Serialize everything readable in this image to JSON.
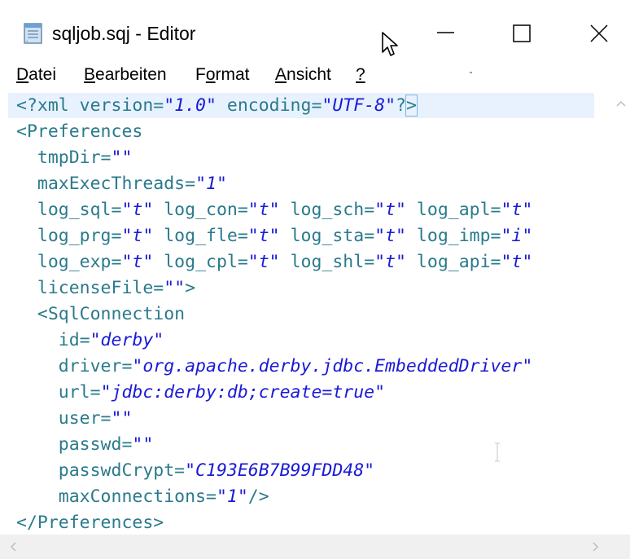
{
  "window": {
    "title": "sqljob.sqj - Editor"
  },
  "menu": {
    "items": [
      {
        "label": "Datei",
        "accel_index": 0
      },
      {
        "label": "Bearbeiten",
        "accel_index": 0
      },
      {
        "label": "Format",
        "accel_index": 1
      },
      {
        "label": "Ansicht",
        "accel_index": 0
      },
      {
        "label": "?",
        "accel_index": 0
      }
    ]
  },
  "icons": {
    "app": "notepad-icon",
    "minimize": "minimize-icon",
    "maximize": "maximize-icon",
    "close": "close-icon",
    "mouse": "mouse-pointer-icon",
    "text_cursor": "text-cursor-icon",
    "scroll_up": "chevron-up-icon",
    "scroll_left": "chevron-left-icon",
    "scroll_right": "chevron-right-icon"
  },
  "colors": {
    "markup": "#2a7a8c",
    "value": "#1a1ad6",
    "current_line": "#e8f2fe"
  },
  "editor": {
    "lines": [
      [
        {
          "t": "p",
          "s": "<?xml version="
        },
        {
          "t": "v",
          "s": "\"1.0\""
        },
        {
          "t": "p",
          "s": " encoding="
        },
        {
          "t": "v",
          "s": "\"UTF-8\""
        },
        {
          "t": "p",
          "s": "?"
        },
        {
          "t": "b",
          "s": ">"
        }
      ],
      [
        {
          "t": "p",
          "s": "<Preferences"
        }
      ],
      [
        {
          "t": "p",
          "s": "  tmpDir="
        },
        {
          "t": "v",
          "s": "\"\""
        }
      ],
      [
        {
          "t": "p",
          "s": "  maxExecThreads="
        },
        {
          "t": "v",
          "s": "\"1\""
        }
      ],
      [
        {
          "t": "p",
          "s": "  log_sql="
        },
        {
          "t": "v",
          "s": "\"t\""
        },
        {
          "t": "p",
          "s": " log_con="
        },
        {
          "t": "v",
          "s": "\"t\""
        },
        {
          "t": "p",
          "s": " log_sch="
        },
        {
          "t": "v",
          "s": "\"t\""
        },
        {
          "t": "p",
          "s": " log_apl="
        },
        {
          "t": "v",
          "s": "\"t\""
        }
      ],
      [
        {
          "t": "p",
          "s": "  log_prg="
        },
        {
          "t": "v",
          "s": "\"t\""
        },
        {
          "t": "p",
          "s": " log_fle="
        },
        {
          "t": "v",
          "s": "\"t\""
        },
        {
          "t": "p",
          "s": " log_sta="
        },
        {
          "t": "v",
          "s": "\"t\""
        },
        {
          "t": "p",
          "s": " log_imp="
        },
        {
          "t": "v",
          "s": "\"i\""
        }
      ],
      [
        {
          "t": "p",
          "s": "  log_exp="
        },
        {
          "t": "v",
          "s": "\"t\""
        },
        {
          "t": "p",
          "s": " log_cpl="
        },
        {
          "t": "v",
          "s": "\"t\""
        },
        {
          "t": "p",
          "s": " log_shl="
        },
        {
          "t": "v",
          "s": "\"t\""
        },
        {
          "t": "p",
          "s": " log_api="
        },
        {
          "t": "v",
          "s": "\"t\""
        }
      ],
      [
        {
          "t": "p",
          "s": "  licenseFile="
        },
        {
          "t": "v",
          "s": "\"\""
        },
        {
          "t": "p",
          "s": ">"
        }
      ],
      [
        {
          "t": "p",
          "s": "  <SqlConnection"
        }
      ],
      [
        {
          "t": "p",
          "s": "    id="
        },
        {
          "t": "v",
          "s": "\"derby\""
        }
      ],
      [
        {
          "t": "p",
          "s": "    driver="
        },
        {
          "t": "v",
          "s": "\"org.apache.derby.jdbc.EmbeddedDriver\""
        }
      ],
      [
        {
          "t": "p",
          "s": "    url="
        },
        {
          "t": "v",
          "s": "\"jdbc:derby:db;create=true\""
        }
      ],
      [
        {
          "t": "p",
          "s": "    user="
        },
        {
          "t": "v",
          "s": "\"\""
        }
      ],
      [
        {
          "t": "p",
          "s": "    passwd="
        },
        {
          "t": "v",
          "s": "\"\""
        }
      ],
      [
        {
          "t": "p",
          "s": "    passwdCrypt="
        },
        {
          "t": "v",
          "s": "\"C193E6B7B99FDD48\""
        }
      ],
      [
        {
          "t": "p",
          "s": "    maxConnections="
        },
        {
          "t": "v",
          "s": "\"1\""
        },
        {
          "t": "p",
          "s": "/>"
        }
      ],
      [
        {
          "t": "p",
          "s": "</Preferences>"
        }
      ]
    ]
  }
}
